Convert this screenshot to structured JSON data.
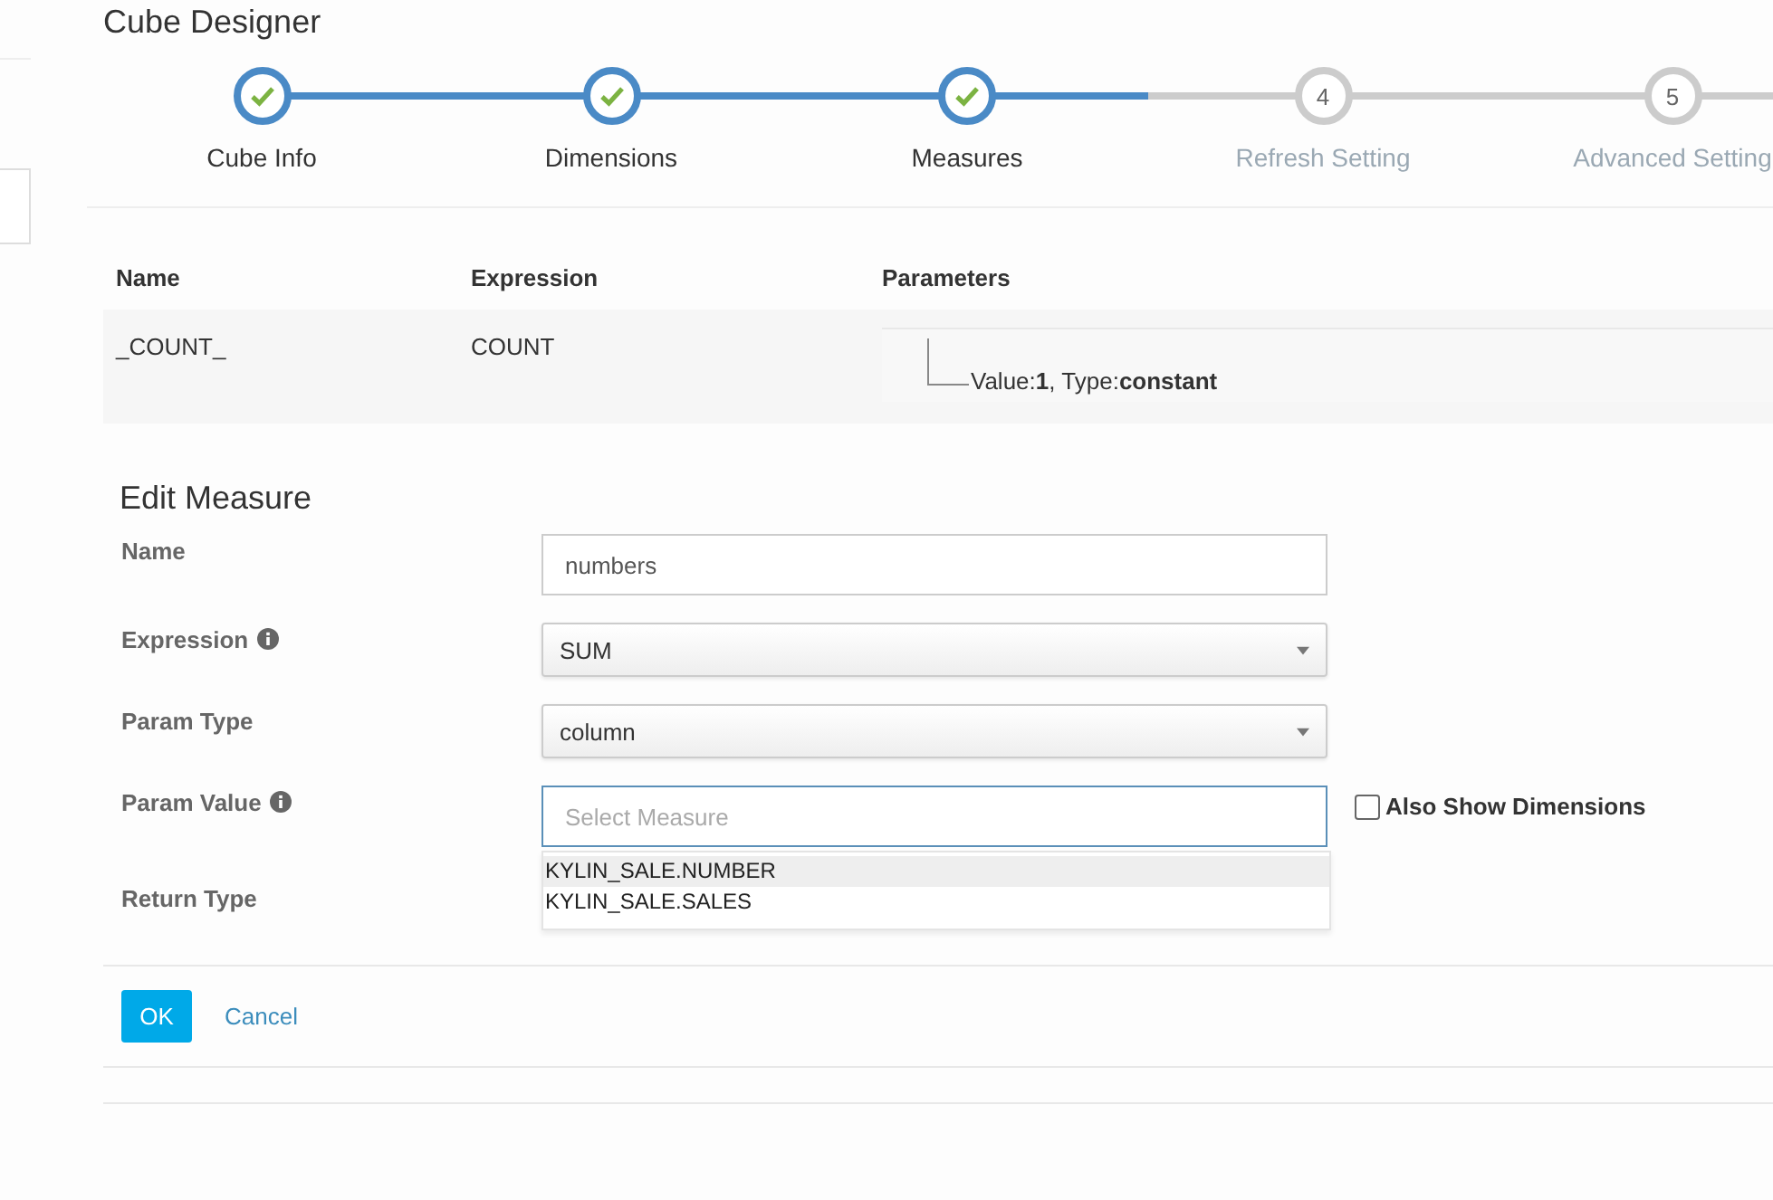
{
  "page_title": "Cube Designer",
  "steps": [
    {
      "label": "Cube Info",
      "done": true
    },
    {
      "label": "Dimensions",
      "done": true
    },
    {
      "label": "Measures",
      "done": true
    },
    {
      "label": "Refresh Setting",
      "done": false,
      "number": "4"
    },
    {
      "label": "Advanced Setting",
      "done": false,
      "number": "5"
    }
  ],
  "measures_table": {
    "columns": [
      "Name",
      "Expression",
      "Parameters"
    ],
    "rows": [
      {
        "name": "_COUNT_",
        "expression": "COUNT",
        "parameters": "Value:**1**, Type:**constant**"
      }
    ]
  },
  "edit_measure": {
    "title": "Edit Measure",
    "fields": [
      {
        "label": "Name",
        "info": false,
        "kind": "input",
        "value": "numbers"
      },
      {
        "label": "Expression",
        "info": true,
        "kind": "select",
        "value": "SUM"
      },
      {
        "label": "Param Type",
        "info": false,
        "kind": "select",
        "value": "column"
      },
      {
        "label": "Param Value",
        "info": true,
        "kind": "combo",
        "placeholder": "Select Measure",
        "options": [
          {
            "label": "KYLIN_SALE.NUMBER",
            "selected": true
          },
          {
            "label": "KYLIN_SALE.SALES",
            "selected": false
          }
        ],
        "checkbox": {
          "label": "Also Show Dimensions",
          "checked": false
        }
      },
      {
        "label": "Return Type",
        "info": false,
        "kind": "none"
      }
    ],
    "buttons": [
      {
        "label": "OK",
        "kind": "primary"
      },
      {
        "label": "Cancel",
        "kind": "link"
      }
    ]
  }
}
